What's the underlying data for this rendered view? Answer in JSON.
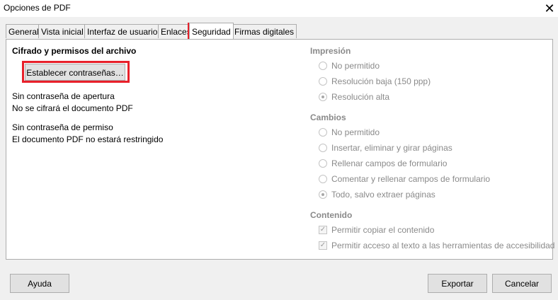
{
  "window": {
    "title": "Opciones de PDF",
    "close_glyph": "✕"
  },
  "tabs": [
    {
      "label": "General"
    },
    {
      "label": "Vista inicial"
    },
    {
      "label": "Interfaz de usuario"
    },
    {
      "label": "Enlaces"
    },
    {
      "label": "Seguridad",
      "active": true
    },
    {
      "label": "Firmas digitales"
    }
  ],
  "security": {
    "heading": "Cifrado y permisos del archivo",
    "set_passwords_button": "Establecer contraseñas…",
    "open_password_status": "Sin contraseña de apertura",
    "open_password_note": "No se cifrará el documento PDF",
    "permission_password_status": "Sin contraseña de permiso",
    "permission_password_note": "El documento PDF no estará restringido"
  },
  "printing": {
    "heading": "Impresión",
    "options": [
      {
        "label": "No permitido",
        "checked": false
      },
      {
        "label": "Resolución baja (150 ppp)",
        "checked": false
      },
      {
        "label": "Resolución alta",
        "checked": true
      }
    ]
  },
  "changes": {
    "heading": "Cambios",
    "options": [
      {
        "label": "No permitido",
        "checked": false
      },
      {
        "label": "Insertar, eliminar y girar páginas",
        "checked": false
      },
      {
        "label": "Rellenar campos de formulario",
        "checked": false
      },
      {
        "label": "Comentar y rellenar campos de formulario",
        "checked": false
      },
      {
        "label": "Todo, salvo extraer páginas",
        "checked": true
      }
    ]
  },
  "content": {
    "heading": "Contenido",
    "options": [
      {
        "label": "Permitir copiar el contenido",
        "checked": true
      },
      {
        "label": "Permitir acceso al texto a las herramientas de accesibilidad",
        "checked": true
      }
    ]
  },
  "footer": {
    "help_button": "Ayuda",
    "export_button": "Exportar",
    "cancel_button": "Cancelar"
  },
  "highlight_color": "#e8202a"
}
